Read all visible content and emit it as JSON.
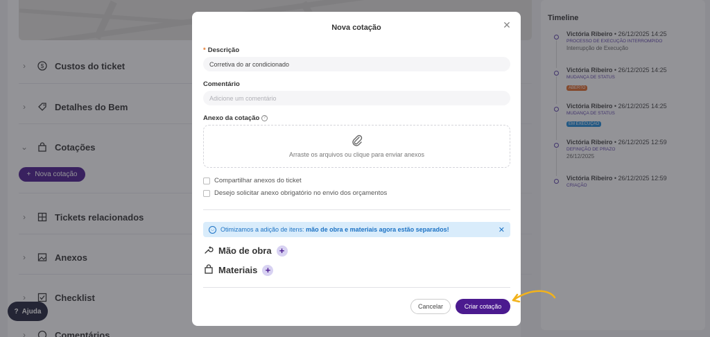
{
  "background": {
    "sections": [
      {
        "label": "Custos do ticket",
        "icon": "dollar-icon"
      },
      {
        "label": "Detalhes do Bem",
        "icon": "tag-icon"
      },
      {
        "label": "Cotações",
        "icon": "bag-icon"
      },
      {
        "label": "Tickets relacionados",
        "icon": "link-icon"
      },
      {
        "label": "Anexos",
        "icon": "image-icon"
      },
      {
        "label": "Checklist",
        "icon": "checkbox-icon"
      },
      {
        "label": "Comentários",
        "icon": "comment-icon"
      }
    ],
    "nova_cotacao_label": "Nova cotação",
    "help_label": "Ajuda"
  },
  "timeline": {
    "title": "Timeline",
    "items": [
      {
        "author": "Victória Ribeiro",
        "date": "26/12/2025 14:25",
        "event": "PROCESSO DE EXECUÇÃO INTERROMPIDO",
        "note": "Interrupção de Execução",
        "badge": "",
        "badge_color": ""
      },
      {
        "author": "Victória Ribeiro",
        "date": "26/12/2025 14:25",
        "event": "MUDANÇA DE STATUS",
        "note": "",
        "badge": "ABERTO",
        "badge_color": "#e06a2a"
      },
      {
        "author": "Victória Ribeiro",
        "date": "26/12/2025 14:25",
        "event": "MUDANÇA DE STATUS",
        "note": "",
        "badge": "EM EXECUÇÃO",
        "badge_color": "#1f8ad8"
      },
      {
        "author": "Victória Ribeiro",
        "date": "26/12/2025 12:59",
        "event": "DEFINIÇÃO DE PRAZO",
        "note": "26/12/2025",
        "badge": "",
        "badge_color": ""
      },
      {
        "author": "Victória Ribeiro",
        "date": "26/12/2025 12:59",
        "event": "CRIAÇÃO",
        "note": "",
        "badge": "",
        "badge_color": ""
      }
    ]
  },
  "modal": {
    "title": "Nova cotação",
    "descricao_label": "Descrição",
    "descricao_value": "Corretiva do ar condicionado",
    "comentario_label": "Comentário",
    "comentario_placeholder": "Adicione um comentário",
    "anexo_label": "Anexo da cotação",
    "dropzone_text": "Arraste os arquivos ou clique para enviar anexos",
    "check_compartilhar": "Compartilhar anexos do ticket",
    "check_obrigatorio": "Desejo solicitar anexo obrigatório no envio dos orçamentos",
    "info_text": "Otimizamos a adição de itens:",
    "info_bold": "mão de obra e materiais agora estão separados!",
    "mao_de_obra_label": "Mão de obra",
    "materiais_label": "Materiais",
    "cancel_label": "Cancelar",
    "create_label": "Criar cotação"
  },
  "colors": {
    "primary": "#4b1a8f",
    "info_bg": "#d9ecfb",
    "info_text": "#1c72c4",
    "arrow": "#f2b21b"
  }
}
